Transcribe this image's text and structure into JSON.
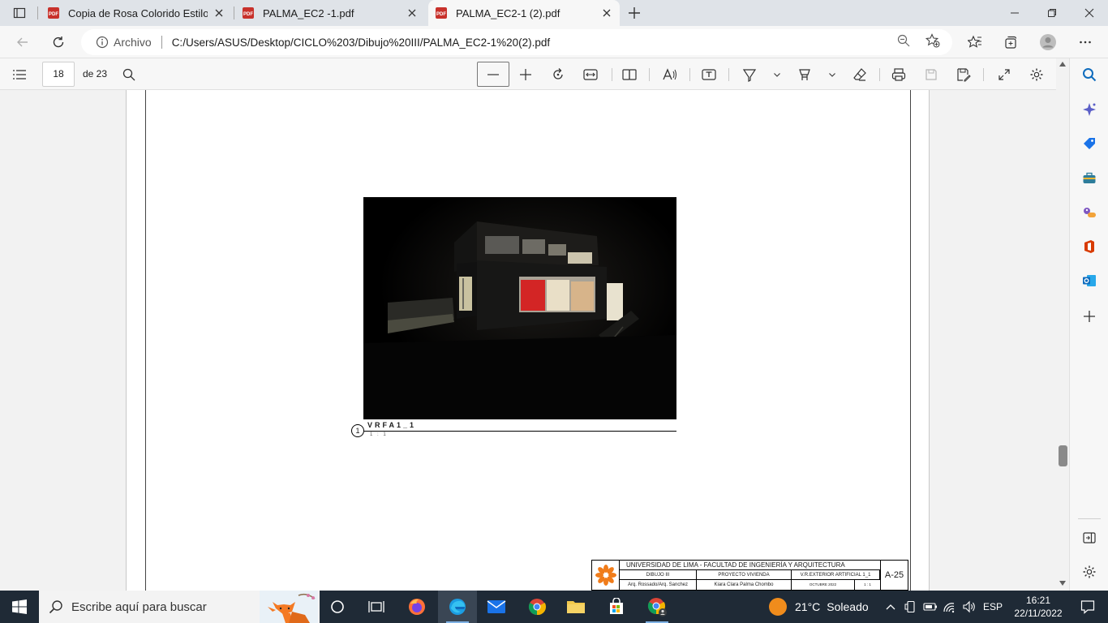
{
  "browser": {
    "tabs": [
      {
        "title": "Copia de Rosa Colorido Estilo Se"
      },
      {
        "title": "PALMA_EC2 -1.pdf"
      },
      {
        "title": "PALMA_EC2-1 (2).pdf"
      }
    ],
    "active_tab": 2,
    "address": {
      "scheme_label": "Archivo",
      "url": "C:/Users/ASUS/Desktop/CICLO%203/Dibujo%20III/PALMA_EC2-1%20(2).pdf"
    }
  },
  "pdf_toolbar": {
    "page_current": "18",
    "page_total_label": "de 23"
  },
  "document": {
    "view_caption": {
      "number": "1",
      "title": "VRFA1_1",
      "scale": "1 : 1"
    },
    "title_block": {
      "university": "UNIVERSIDAD DE LIMA - FACULTAD DE INGENIERÍA Y ARQUITECTURA",
      "course": "DIBUJO III",
      "project": "PROYECTO VIVIENDA",
      "sheet_name": "V.R.EXTERIOR ARTIFICIAL 1_1",
      "teachers": "Arq. Rossado/Arq. Sanchez",
      "student": "Kiara Clara Palma Chombo",
      "date": "OCTUBRE 2022",
      "scale": "1 : 1",
      "sheet_code": "A-25"
    }
  },
  "taskbar": {
    "search_placeholder": "Escribe aquí para buscar",
    "weather": {
      "temp": "21°C",
      "condition": "Soleado"
    },
    "language": "ESP",
    "time": "16:21",
    "date": "22/11/2022"
  },
  "colors": {
    "tab_bar": "#dfe3e8",
    "toolbar": "#f7f7f7",
    "viewer_bg": "#f2f2f2",
    "taskbar": "#1f2a36",
    "pdf_red": "#c8312b",
    "edge_accent": "#0f6cbd"
  }
}
